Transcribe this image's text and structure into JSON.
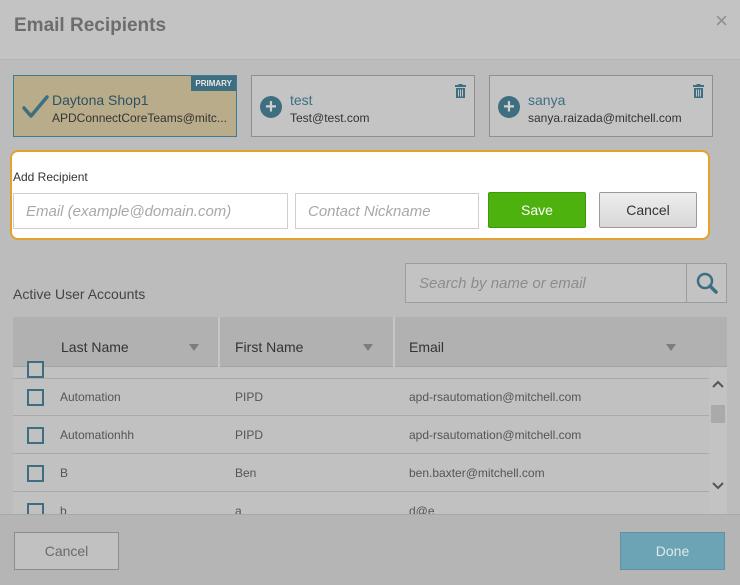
{
  "dialog": {
    "title": "Email Recipients",
    "close_icon": "×"
  },
  "recipients": [
    {
      "name": "Daytona Shop1",
      "email": "APDConnectCoreTeams@mitc...",
      "badge": "PRIMARY"
    },
    {
      "name": "test",
      "email": "Test@test.com"
    },
    {
      "name": "sanya",
      "email": "sanya.raizada@mitchell.com"
    }
  ],
  "add_recipient": {
    "label": "Add Recipient",
    "email_placeholder": "Email (example@domain.com)",
    "nickname_placeholder": "Contact Nickname",
    "save_label": "Save",
    "cancel_label": "Cancel"
  },
  "accounts": {
    "title": "Active User Accounts",
    "search_placeholder": "Search by name or email",
    "columns": [
      "Last Name",
      "First Name",
      "Email"
    ],
    "rows": [
      {
        "last": "Automation",
        "first": "PIPD",
        "email": "apd-rsautomation@mitchell.com"
      },
      {
        "last": "Automationhh",
        "first": "PIPD",
        "email": "apd-rsautomation@mitchell.com"
      },
      {
        "last": "B",
        "first": "Ben",
        "email": "ben.baxter@mitchell.com"
      },
      {
        "last": "b",
        "first": "a",
        "email": "d@e"
      }
    ]
  },
  "footer": {
    "cancel_label": "Cancel",
    "done_label": "Done"
  },
  "colors": {
    "accent": "#3d6f80",
    "save": "#4db10e",
    "focus_border": "#e3a12e",
    "done": "#6ca4b5"
  }
}
